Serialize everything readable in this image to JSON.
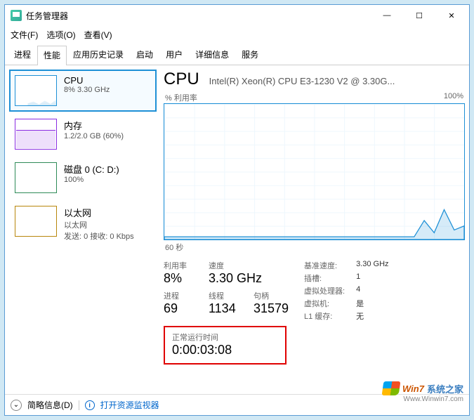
{
  "window": {
    "title": "任务管理器"
  },
  "window_controls": {
    "min": "—",
    "max": "☐",
    "close": "✕"
  },
  "menu": {
    "file": "文件(F)",
    "options": "选项(O)",
    "view": "查看(V)"
  },
  "tabs": [
    {
      "label": "进程"
    },
    {
      "label": "性能"
    },
    {
      "label": "应用历史记录"
    },
    {
      "label": "启动"
    },
    {
      "label": "用户"
    },
    {
      "label": "详细信息"
    },
    {
      "label": "服务"
    }
  ],
  "sidebar": [
    {
      "title": "CPU",
      "sub": "8% 3.30 GHz"
    },
    {
      "title": "内存",
      "sub": "1.2/2.0 GB (60%)"
    },
    {
      "title": "磁盘 0 (C: D:)",
      "sub": "100%"
    },
    {
      "title": "以太网",
      "sub1": "以太网",
      "sub2": "发送: 0 接收: 0 Kbps"
    }
  ],
  "main": {
    "title": "CPU",
    "subtitle": "Intel(R) Xeon(R) CPU E3-1230 V2 @ 3.30G...",
    "chart_top_left": "% 利用率",
    "chart_top_right": "100%",
    "chart_bottom": "60 秒",
    "stats": {
      "util_label": "利用率",
      "util_val": "8%",
      "speed_label": "速度",
      "speed_val": "3.30 GHz",
      "proc_label": "进程",
      "proc_val": "69",
      "thread_label": "线程",
      "thread_val": "1134",
      "handle_label": "句柄",
      "handle_val": "31579"
    },
    "details": {
      "base_k": "基准速度:",
      "base_v": "3.30 GHz",
      "sock_k": "插槽:",
      "sock_v": "1",
      "vproc_k": "虚拟处理器:",
      "vproc_v": "4",
      "vm_k": "虚拟机:",
      "vm_v": "是",
      "l1_k": "L1 缓存:",
      "l1_v": "无"
    },
    "uptime_label": "正常运行时间",
    "uptime_val": "0:00:03:08"
  },
  "footer": {
    "less": "简略信息(D)",
    "resmon": "打开资源监视器"
  },
  "watermark": {
    "t1": "Win7",
    "t2": "系统之家",
    "url": "Www.Winwin7.com"
  },
  "chart_data": {
    "type": "line",
    "title": "% 利用率",
    "ylim": [
      0,
      100
    ],
    "xlabel": "60 秒",
    "x": [
      0,
      2,
      4,
      6,
      8,
      10,
      12,
      14,
      16,
      18,
      20,
      22,
      24,
      26,
      28,
      30,
      32,
      34,
      36,
      38,
      40,
      42,
      44,
      46,
      48,
      50,
      52,
      54,
      56,
      58,
      60
    ],
    "values": [
      2,
      2,
      2,
      2,
      2,
      2,
      2,
      2,
      2,
      2,
      2,
      2,
      2,
      2,
      2,
      2,
      2,
      2,
      2,
      2,
      2,
      2,
      2,
      2,
      2,
      2,
      14,
      5,
      22,
      7,
      10
    ]
  }
}
